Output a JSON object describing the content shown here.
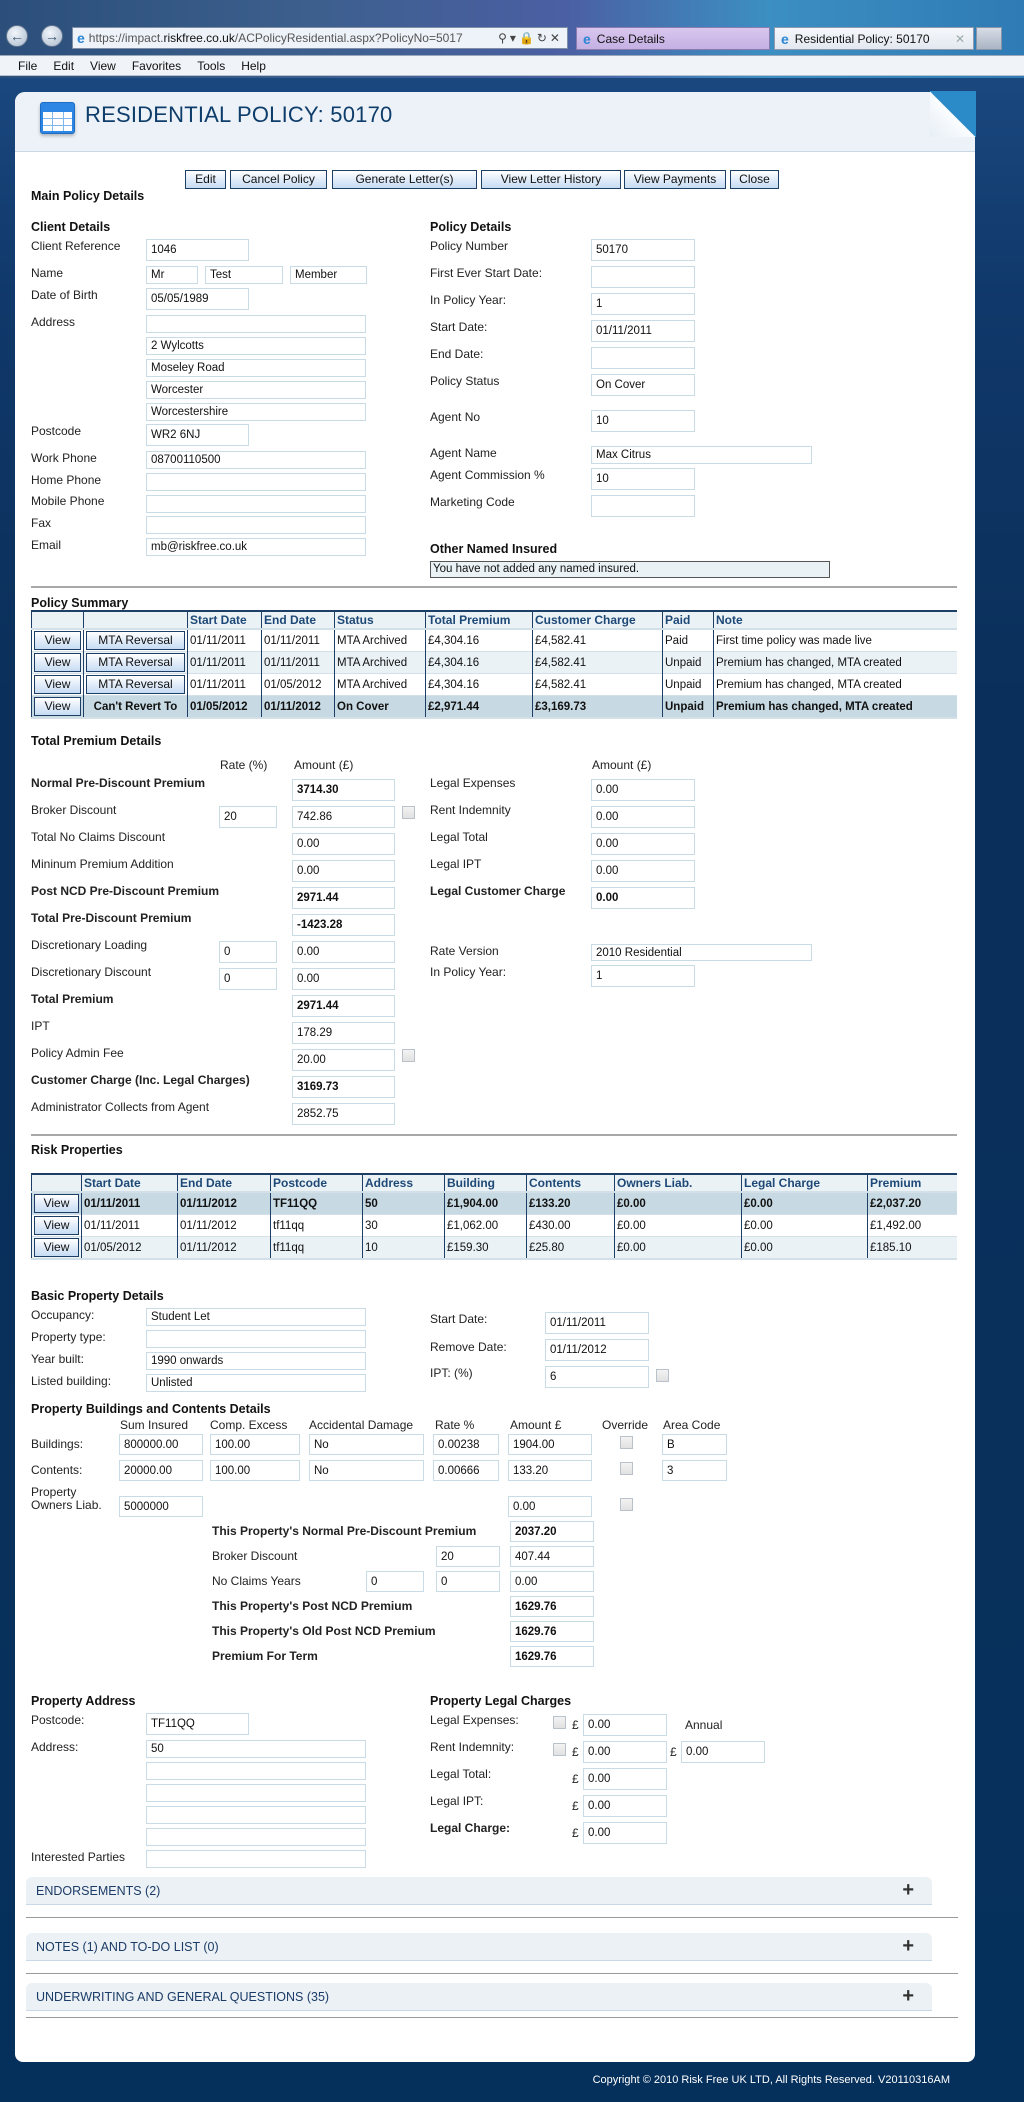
{
  "browser": {
    "url_prefix": "https://impact.",
    "url_domain": "riskfree.co.uk",
    "url_rest": "/ACPolicyResidential.aspx?PolicyNo=5017",
    "tabs": [
      {
        "label": "Case Details"
      },
      {
        "label": "Residential Policy: 50170"
      }
    ],
    "menu": [
      "File",
      "Edit",
      "View",
      "Favorites",
      "Tools",
      "Help"
    ]
  },
  "page": {
    "title": "RESIDENTIAL POLICY: 50170",
    "main_heading": "Main Policy Details"
  },
  "toolbar": {
    "edit": "Edit",
    "cancel_policy": "Cancel Policy",
    "generate_letters": "Generate Letter(s)",
    "view_letter_history": "View Letter History",
    "view_payments": "View Payments",
    "close": "Close"
  },
  "client": {
    "heading": "Client Details",
    "client_reference_label": "Client Reference",
    "client_reference": "1046",
    "name_label": "Name",
    "title": "Mr",
    "first_name": "Test",
    "last_name": "Member",
    "dob_label": "Date of Birth",
    "dob": "05/05/1989",
    "address_label": "Address",
    "address": [
      "",
      "2 Wylcotts",
      "Moseley Road",
      "Worcester",
      "Worcestershire"
    ],
    "postcode_label": "Postcode",
    "postcode": "WR2 6NJ",
    "work_phone_label": "Work Phone",
    "work_phone": "08700110500",
    "home_phone_label": "Home Phone",
    "home_phone": "",
    "mobile_phone_label": "Mobile Phone",
    "mobile_phone": "",
    "fax_label": "Fax",
    "fax": "",
    "email_label": "Email",
    "email": "mb@riskfree.co.uk"
  },
  "policy": {
    "heading": "Policy Details",
    "policy_number_label": "Policy Number",
    "policy_number": "50170",
    "first_start_label": "First Ever Start Date:",
    "first_start": "",
    "in_policy_year_label": "In Policy Year:",
    "in_policy_year": "1",
    "start_date_label": "Start Date:",
    "start_date": "01/11/2011",
    "end_date_label": "End Date:",
    "end_date": "",
    "status_label": "Policy Status",
    "status": "On Cover",
    "agent_no_label": "Agent No",
    "agent_no": "10",
    "agent_name_label": "Agent Name",
    "agent_name": "Max Citrus",
    "agent_commission_label": "Agent Commission %",
    "agent_commission": "10",
    "marketing_code_label": "Marketing Code",
    "marketing_code": "",
    "other_named_heading": "Other Named Insured",
    "other_named_message": "You have not added any named insured."
  },
  "policy_summary": {
    "heading": "Policy Summary",
    "columns": [
      "",
      "",
      "Start Date",
      "End Date",
      "Status",
      "Total Premium",
      "Customer Charge",
      "Paid",
      "Note"
    ],
    "rows": [
      {
        "view": "View",
        "action": "MTA Reversal",
        "start": "01/11/2011",
        "end": "01/11/2011",
        "status": "MTA Archived",
        "total": "£4,304.16",
        "charge": "£4,582.41",
        "paid": "Paid",
        "note": "First time policy was made live"
      },
      {
        "view": "View",
        "action": "MTA Reversal",
        "start": "01/11/2011",
        "end": "01/11/2011",
        "status": "MTA Archived",
        "total": "£4,304.16",
        "charge": "£4,582.41",
        "paid": "Unpaid",
        "note": "Premium has changed, MTA created"
      },
      {
        "view": "View",
        "action": "MTA Reversal",
        "start": "01/11/2011",
        "end": "01/05/2012",
        "status": "MTA Archived",
        "total": "£4,304.16",
        "charge": "£4,582.41",
        "paid": "Unpaid",
        "note": "Premium has changed, MTA created"
      },
      {
        "view": "View",
        "action": "Can't Revert To",
        "start": "01/05/2012",
        "end": "01/11/2012",
        "status": "On Cover",
        "total": "£2,971.44",
        "charge": "£3,169.73",
        "paid": "Unpaid",
        "note": "Premium has changed, MTA created"
      }
    ]
  },
  "premium": {
    "heading": "Total Premium Details",
    "rate_header": "Rate (%)",
    "amount_header": "Amount (£)",
    "rows": [
      {
        "label": "Normal Pre-Discount Premium",
        "rate": null,
        "amount": "3714.30",
        "bold": true
      },
      {
        "label": "Broker Discount",
        "rate": "20",
        "amount": "742.86"
      },
      {
        "label": "Total No Claims Discount",
        "rate": null,
        "amount": "0.00"
      },
      {
        "label": "Mininum Premium Addition",
        "rate": null,
        "amount": "0.00"
      },
      {
        "label": "Post NCD Pre-Discount Premium",
        "rate": null,
        "amount": "2971.44",
        "bold": true
      },
      {
        "label": "Total Pre-Discount Premium",
        "rate": null,
        "amount": "-1423.28",
        "bold": true
      },
      {
        "label": "Discretionary Loading",
        "rate": "0",
        "amount": "0.00"
      },
      {
        "label": "Discretionary Discount",
        "rate": "0",
        "amount": "0.00"
      },
      {
        "label": "Total Premium",
        "rate": null,
        "amount": "2971.44",
        "bold": true
      },
      {
        "label": "IPT",
        "rate": null,
        "amount": "178.29"
      },
      {
        "label": "Policy Admin Fee",
        "rate": null,
        "amount": "20.00"
      },
      {
        "label": "Customer Charge (Inc. Legal Charges)",
        "rate": null,
        "amount": "3169.73",
        "bold": true
      },
      {
        "label": "Administrator Collects from Agent",
        "rate": null,
        "amount": "2852.75"
      }
    ],
    "legal_amount_header": "Amount (£)",
    "legal_rows": [
      {
        "label": "Legal Expenses",
        "amount": "0.00"
      },
      {
        "label": "Rent Indemnity",
        "amount": "0.00"
      },
      {
        "label": "Legal Total",
        "amount": "0.00"
      },
      {
        "label": "Legal IPT",
        "amount": "0.00"
      },
      {
        "label": "Legal Customer Charge",
        "amount": "0.00",
        "bold": true
      }
    ],
    "rate_version_label": "Rate Version",
    "rate_version": "2010 Residential",
    "in_policy_year_label": "In Policy Year:",
    "in_policy_year": "1"
  },
  "risk_properties": {
    "heading": "Risk Properties",
    "columns": [
      "",
      "Start Date",
      "End Date",
      "Postcode",
      "Address",
      "Building",
      "Contents",
      "Owners Liab.",
      "Legal Charge",
      "Premium"
    ],
    "rows": [
      {
        "view": "View",
        "start": "01/11/2011",
        "end": "01/11/2012",
        "postcode": "TF11QQ",
        "address": "50",
        "building": "£1,904.00",
        "contents": "£133.20",
        "owners": "£0.00",
        "legal": "£0.00",
        "premium": "£2,037.20"
      },
      {
        "view": "View",
        "start": "01/11/2011",
        "end": "01/11/2012",
        "postcode": "tf11qq",
        "address": "30",
        "building": "£1,062.00",
        "contents": "£430.00",
        "owners": "£0.00",
        "legal": "£0.00",
        "premium": "£1,492.00"
      },
      {
        "view": "View",
        "start": "01/05/2012",
        "end": "01/11/2012",
        "postcode": "tf11qq",
        "address": "10",
        "building": "£159.30",
        "contents": "£25.80",
        "owners": "£0.00",
        "legal": "£0.00",
        "premium": "£185.10"
      }
    ]
  },
  "basic_property": {
    "heading": "Basic Property Details",
    "occupancy_label": "Occupancy:",
    "occupancy": "Student Let",
    "type_label": "Property type:",
    "type": "",
    "year_label": "Year built:",
    "year": "1990 onwards",
    "listed_label": "Listed building:",
    "listed": "Unlisted",
    "start_label": "Start Date:",
    "start": "01/11/2011",
    "remove_label": "Remove Date:",
    "remove": "01/11/2012",
    "ipt_label": "IPT: (%)",
    "ipt": "6"
  },
  "buildings_contents": {
    "heading": "Property Buildings and Contents Details",
    "columns": [
      "Sum Insured",
      "Comp. Excess",
      "Accidental Damage",
      "Rate %",
      "Amount £",
      "Override",
      "Area Code"
    ],
    "buildings": {
      "label": "Buildings:",
      "sum": "800000.00",
      "excess": "100.00",
      "accidental": "No",
      "rate": "0.00238",
      "amount": "1904.00",
      "area": "B"
    },
    "contents": {
      "label": "Contents:",
      "sum": "20000.00",
      "excess": "100.00",
      "accidental": "No",
      "rate": "0.00666",
      "amount": "133.20",
      "area": "3"
    },
    "owners": {
      "label_line1": "Property",
      "label_line2": "Owners Liab.",
      "sum": "5000000",
      "amount": "0.00"
    },
    "normal_label": "This Property's Normal Pre-Discount Premium",
    "normal": "2037.20",
    "broker_label": "Broker Discount",
    "broker_rate": "20",
    "broker": "407.44",
    "ncy_label": "No Claims Years",
    "ncy_years": "0",
    "ncy_rate": "0",
    "ncy": "0.00",
    "post_ncd_label": "This Property's Post NCD Premium",
    "post_ncd": "1629.76",
    "old_post_ncd_label": "This Property's Old Post NCD Premium",
    "old_post_ncd": "1629.76",
    "term_label": "Premium For Term",
    "term": "1629.76"
  },
  "property_address": {
    "heading": "Property Address",
    "postcode_label": "Postcode:",
    "postcode": "TF11QQ",
    "address_label": "Address:",
    "address": [
      "50",
      "",
      "",
      "",
      ""
    ],
    "interested_label": "Interested Parties",
    "interested": ""
  },
  "legal_charges": {
    "heading": "Property Legal Charges",
    "currency": "£",
    "annual_label": "Annual",
    "legal_expenses_label": "Legal Expenses:",
    "legal_expenses": "0.00",
    "rent_indemnity_label": "Rent Indemnity:",
    "rent_indemnity": "0.00",
    "rent_indemnity_annual": "0.00",
    "legal_total_label": "Legal Total:",
    "legal_total": "0.00",
    "legal_ipt_label": "Legal IPT:",
    "legal_ipt": "0.00",
    "legal_charge_label": "Legal Charge:",
    "legal_charge": "0.00"
  },
  "accordions": [
    {
      "label": "ENDORSEMENTS (2)"
    },
    {
      "label": "NOTES (1) AND TO-DO LIST (0)"
    },
    {
      "label": "UNDERWRITING AND GENERAL QUESTIONS (35)"
    }
  ],
  "footer": "Copyright © 2010 Risk Free UK LTD, All Rights Reserved. V20110316AM"
}
